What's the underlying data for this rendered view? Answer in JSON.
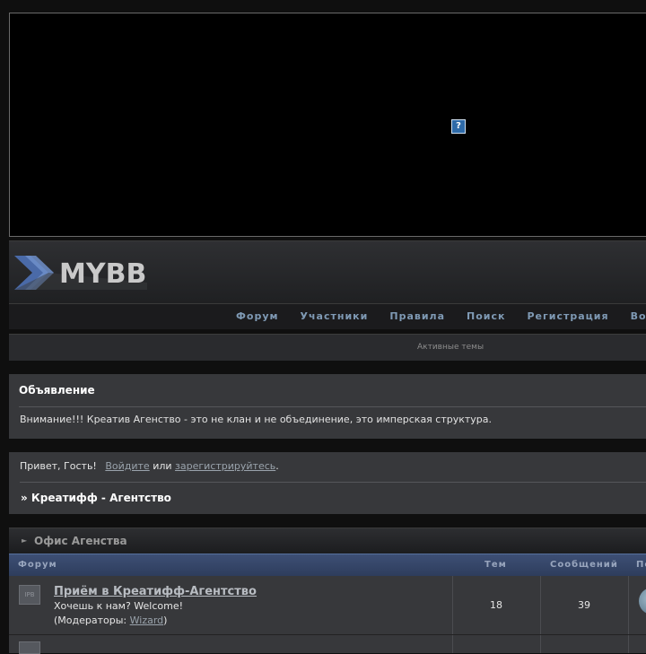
{
  "nav": {
    "items": [
      "Форум",
      "Участники",
      "Правила",
      "Поиск",
      "Регистрация",
      "Во"
    ]
  },
  "subnav": {
    "active_topics": "Активные темы"
  },
  "logo": {
    "text": "MYBB"
  },
  "plugin": {
    "glyph": "?"
  },
  "announcement": {
    "title": "Объявление",
    "text": "Внимание!!! Креатив Агенство - это не клан и не объединение, это имперская структура."
  },
  "guest": {
    "greeting": "Привет, Гость!",
    "login": "Войдите",
    "or": "или",
    "register": "зарегистрируйтесь",
    "period": "."
  },
  "breadcrumb": {
    "text": "» Креатифф - Агентство"
  },
  "category": {
    "title": "Офис Агенства"
  },
  "table": {
    "headers": {
      "forum": "Форум",
      "topics": "Тем",
      "posts": "Сообщений",
      "last": "По"
    },
    "rows": [
      {
        "name": "Приём в Креатифф-Агентство",
        "desc": "Хочешь к нам? Welcome!",
        "mods_prefix": "(Модераторы: ",
        "mod": "Wizard",
        "mods_suffix": ")",
        "topics": "18",
        "posts": "39"
      }
    ]
  },
  "icons": {
    "forum": "IPB"
  },
  "colors": {
    "accent": "#7f9ab5",
    "table_head": "#3d4f75",
    "panel": "#37383b"
  }
}
